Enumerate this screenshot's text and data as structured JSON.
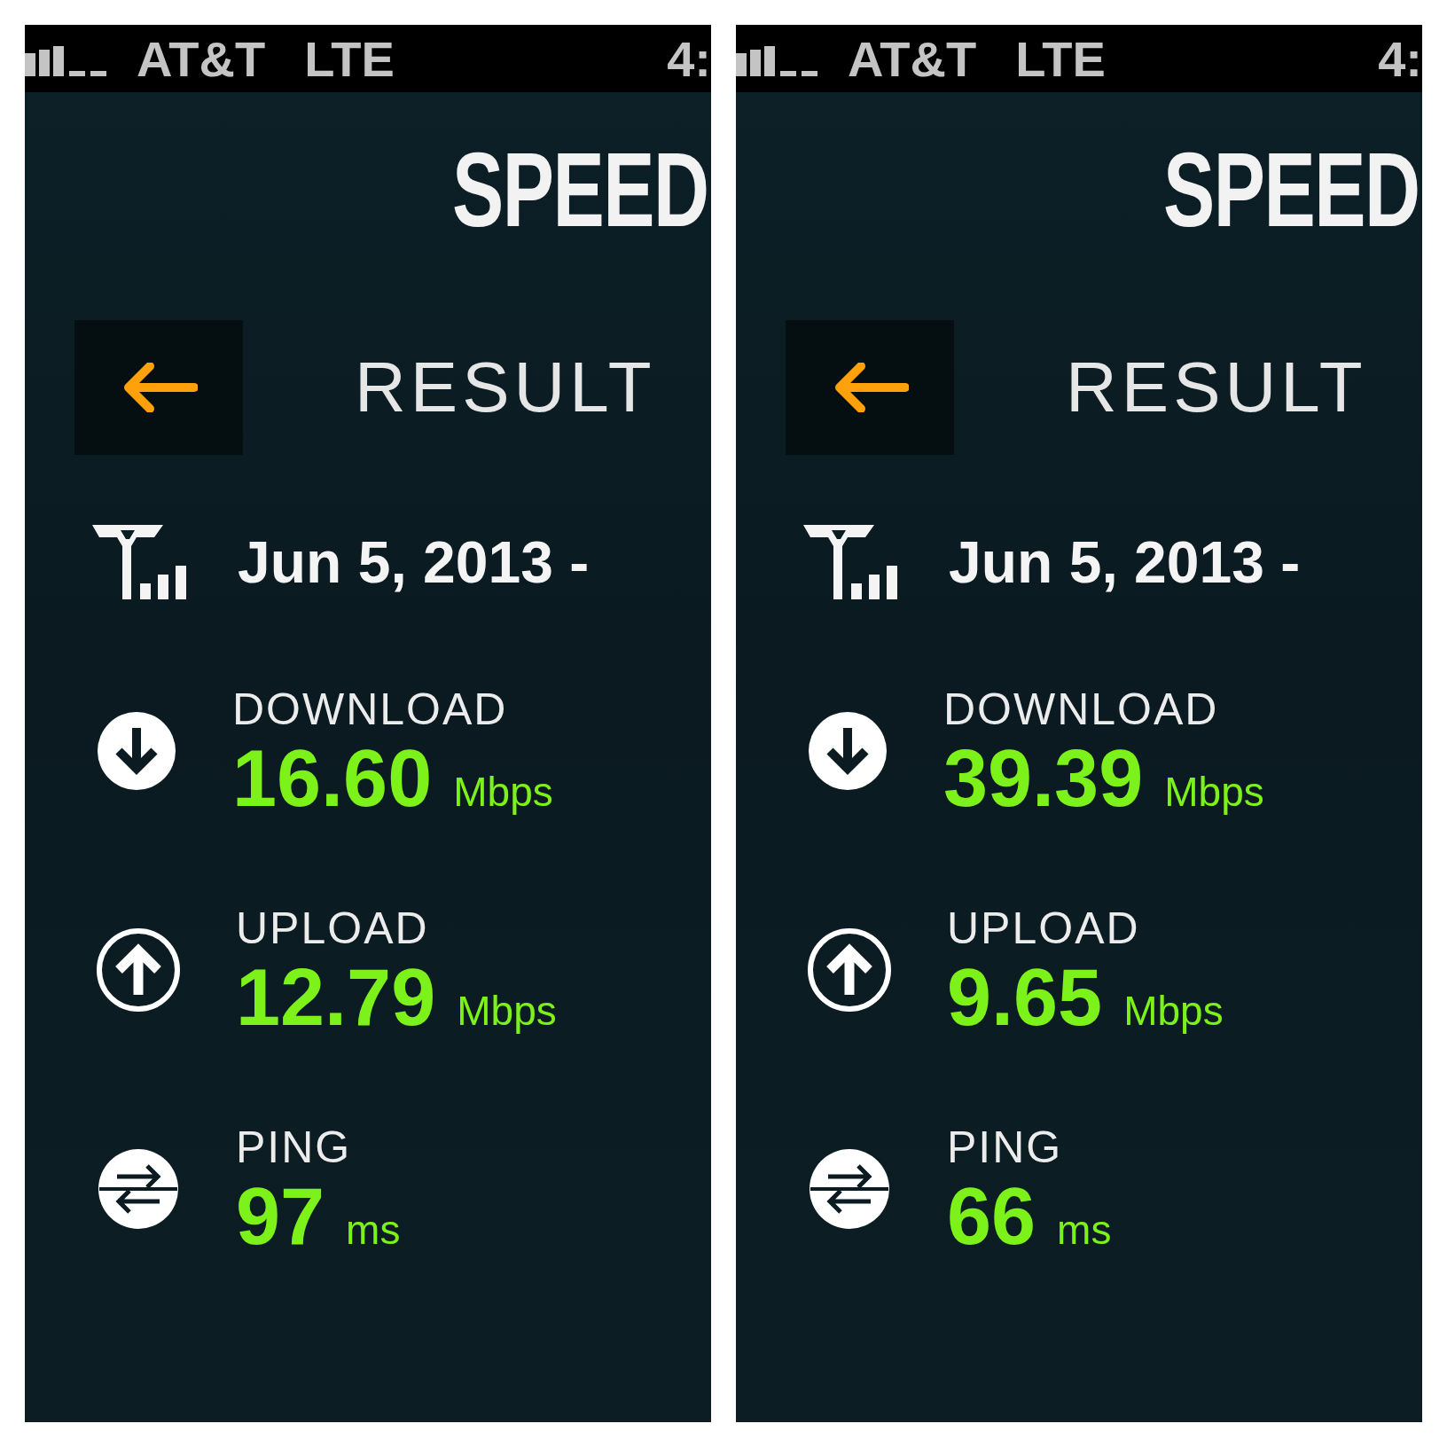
{
  "panels": [
    {
      "status_bar": {
        "carrier": "AT&T",
        "network": "LTE",
        "time": "4:"
      },
      "app_title": "SPEED",
      "header": {
        "title": "RESULT"
      },
      "test": {
        "date": "Jun 5, 2013 -"
      },
      "results": [
        {
          "kind": "download",
          "label": "DOWNLOAD",
          "value": "16.60",
          "unit": "Mbps"
        },
        {
          "kind": "upload",
          "label": "UPLOAD",
          "value": "12.79",
          "unit": "Mbps"
        },
        {
          "kind": "ping",
          "label": "PING",
          "value": "97",
          "unit": "ms"
        }
      ]
    },
    {
      "status_bar": {
        "carrier": "AT&T",
        "network": "LTE",
        "time": "4:"
      },
      "app_title": "SPEED",
      "header": {
        "title": "RESULT"
      },
      "test": {
        "date": "Jun 5, 2013 -"
      },
      "results": [
        {
          "kind": "download",
          "label": "DOWNLOAD",
          "value": "39.39",
          "unit": "Mbps"
        },
        {
          "kind": "upload",
          "label": "UPLOAD",
          "value": "9.65",
          "unit": "Mbps"
        },
        {
          "kind": "ping",
          "label": "PING",
          "value": "66",
          "unit": "ms"
        }
      ]
    }
  ]
}
